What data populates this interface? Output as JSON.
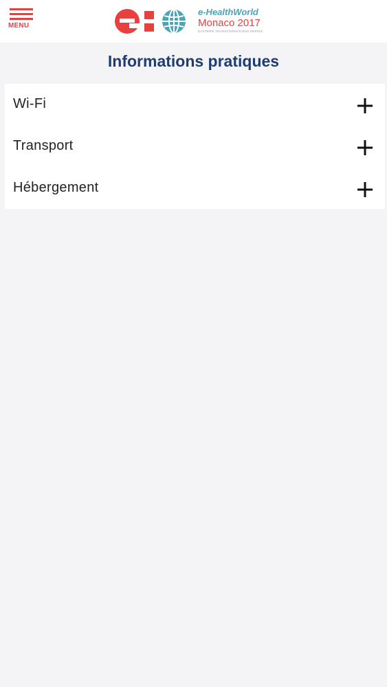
{
  "header": {
    "menu_label": "MENU",
    "logo": {
      "brand_line": "e-HealthWorld",
      "city_line": "Monaco 2017",
      "tagline": "EASTERN TRANSFORMATIONS SERIES"
    }
  },
  "page": {
    "title": "Informations pratiques"
  },
  "accordion": {
    "items": [
      {
        "label": "Wi-Fi",
        "icon": "plus-icon"
      },
      {
        "label": "Transport",
        "icon": "plus-icon"
      },
      {
        "label": "Hébergement",
        "icon": "plus-icon"
      }
    ]
  },
  "colors": {
    "accent_red": "#e8403f",
    "teal": "#4ba5b4",
    "title_blue": "#1f3d6e",
    "background": "#f4f4f7"
  }
}
